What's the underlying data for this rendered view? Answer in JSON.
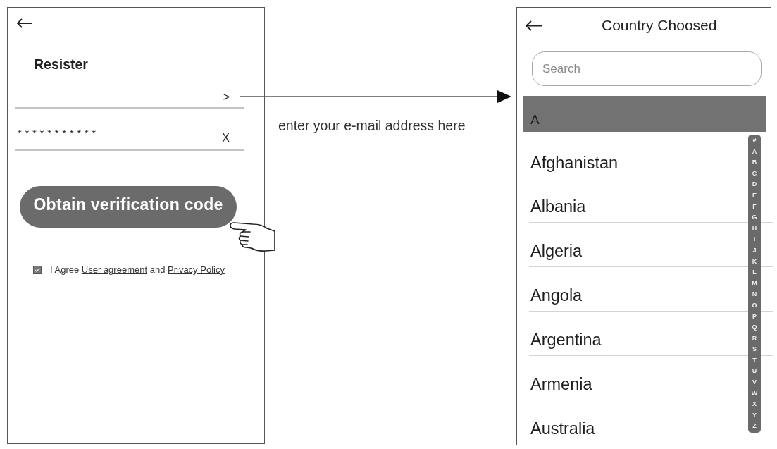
{
  "register_screen": {
    "title": "Resister",
    "email_field": {
      "action": ">"
    },
    "password_field": {
      "value": "***********",
      "action": "X"
    },
    "submit_button": {
      "label": "Obtain verification code"
    },
    "agreement": {
      "checked": true,
      "parts": [
        {
          "kind": "text",
          "text": "I Agree"
        },
        {
          "kind": "link",
          "text": "User agreement"
        },
        {
          "kind": "text",
          "text": "and"
        },
        {
          "kind": "link",
          "text": "Privacy Policy"
        }
      ]
    }
  },
  "annotation": {
    "text": "enter your e-mail address here"
  },
  "country_screen": {
    "title": "Country Choosed",
    "search": {
      "placeholder": "Search"
    },
    "sections": [
      {
        "header": "A",
        "countries": [
          "Afghanistan",
          "Albania",
          "Algeria",
          "Angola",
          "Argentina",
          "Armenia",
          "Australia"
        ]
      }
    ],
    "index": [
      "#",
      "A",
      "B",
      "C",
      "D",
      "E",
      "F",
      "G",
      "H",
      "I",
      "J",
      "K",
      "L",
      "M",
      "N",
      "O",
      "P",
      "Q",
      "R",
      "S",
      "T",
      "U",
      "V",
      "W",
      "X",
      "Y",
      "Z"
    ]
  }
}
